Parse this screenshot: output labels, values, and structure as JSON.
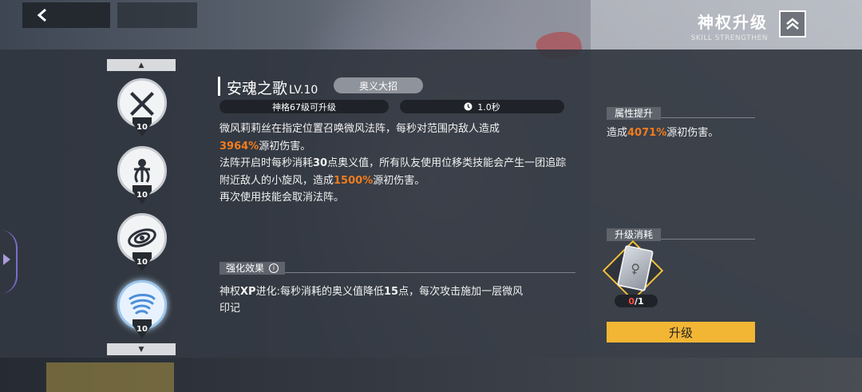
{
  "header": {
    "back_icon": "chevron-left-icon",
    "title": "神权升级",
    "subtitle": "SKILL STRENGTHEN",
    "collapse_icon": "double-chevron-up-icon"
  },
  "skills": [
    {
      "icon": "x-blades-icon",
      "level": "10"
    },
    {
      "icon": "spirit-figure-icon",
      "level": "10"
    },
    {
      "icon": "orbit-rings-icon",
      "level": "10"
    },
    {
      "icon": "whirlwind-icon",
      "level": "10"
    }
  ],
  "skill": {
    "name": "安魂之歌",
    "level": "LV.10",
    "tag": "奥义大招",
    "upgrade_req": "神格67级可升级",
    "cooldown": "1.0秒"
  },
  "description": {
    "line1": "微风莉莉丝在指定位置召唤微风法阵，每秒对范围内敌人造成",
    "val1": "3964%",
    "line2": "源初伤害。",
    "line3a": "法阵开启时每秒消耗",
    "val2": "30",
    "line3b": "点奥义值，所有队友使用位移类技能会产生一团追踪附近敌人的小旋风，造成",
    "val3": "1500%",
    "line3c": "源初伤害。",
    "line4": "再次使用技能会取消法阵。"
  },
  "enhance": {
    "header": "强化效果",
    "text_a": "神权",
    "text_b": "XP",
    "text_c": "进化:每秒消耗的奥义值降低",
    "text_d": "15",
    "text_e": "点，每次攻击施加一层微风印记"
  },
  "attr": {
    "header": "属性提升",
    "prefix": "造成",
    "value": "4071%",
    "suffix": "源初伤害。"
  },
  "cost": {
    "header": "升级消耗",
    "owned": "0",
    "required": "/1",
    "icon": "skill-book-icon"
  },
  "upgrade_label": "升级",
  "colors": {
    "highlight": "#f07c1e",
    "button": "#f3b634",
    "shortage": "#ff4a3a"
  }
}
